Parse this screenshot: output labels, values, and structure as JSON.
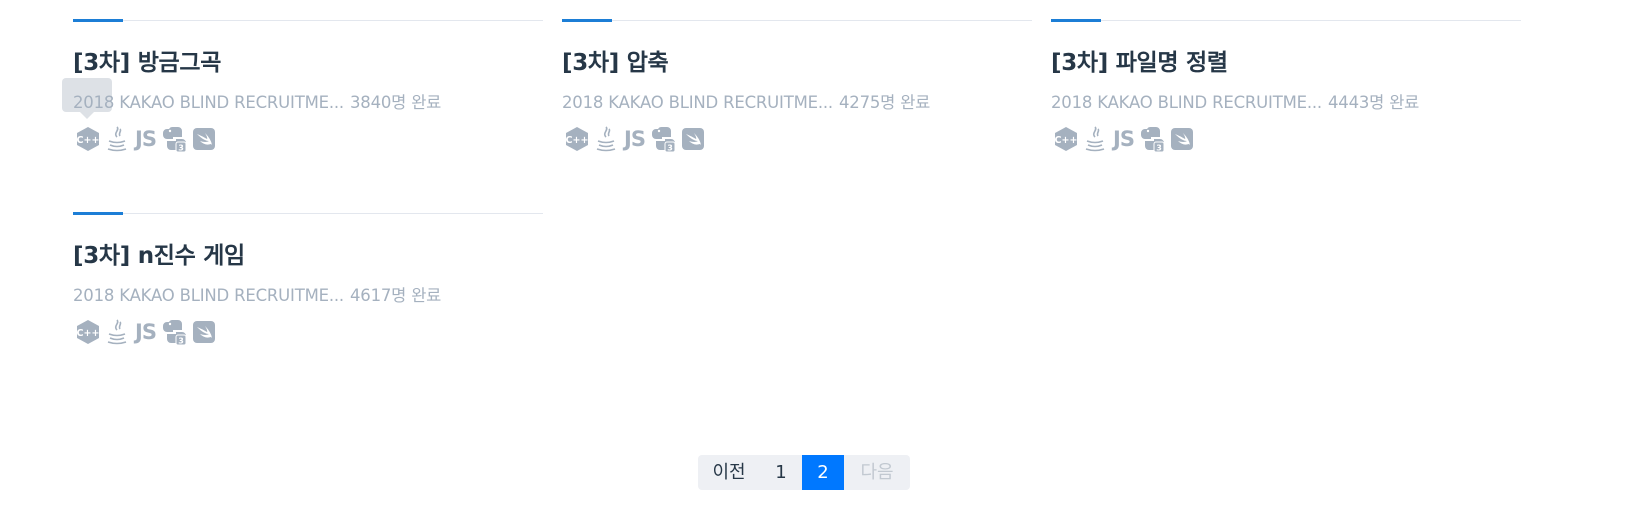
{
  "challenges": [
    {
      "title": "[3차] 방금그곡",
      "source": "2018 KAKAO BLIND RECRUITME...",
      "completions": "3840명 완료",
      "languages": [
        "cpp-icon",
        "java-icon",
        "javascript-icon",
        "python3-icon",
        "swift-icon"
      ]
    },
    {
      "title": "[3차] 압축",
      "source": "2018 KAKAO BLIND RECRUITME...",
      "completions": "4275명 완료",
      "languages": [
        "cpp-icon",
        "java-icon",
        "javascript-icon",
        "python3-icon",
        "swift-icon"
      ]
    },
    {
      "title": "[3차] 파일명 정렬",
      "source": "2018 KAKAO BLIND RECRUITME...",
      "completions": "4443명 완료",
      "languages": [
        "cpp-icon",
        "java-icon",
        "javascript-icon",
        "python3-icon",
        "swift-icon"
      ]
    },
    {
      "title": "[3차] n진수 게임",
      "source": "2018 KAKAO BLIND RECRUITME...",
      "completions": "4617명 완료",
      "languages": [
        "cpp-icon",
        "java-icon",
        "javascript-icon",
        "python3-icon",
        "swift-icon"
      ]
    }
  ],
  "js_label": "JS",
  "pagination": {
    "prev": "이전",
    "pages": [
      "1",
      "2"
    ],
    "current": "2",
    "next": "다음"
  },
  "colors": {
    "accent": "#1c7ed6",
    "active_page": "#0078ff",
    "muted": "#a5b1bf"
  }
}
